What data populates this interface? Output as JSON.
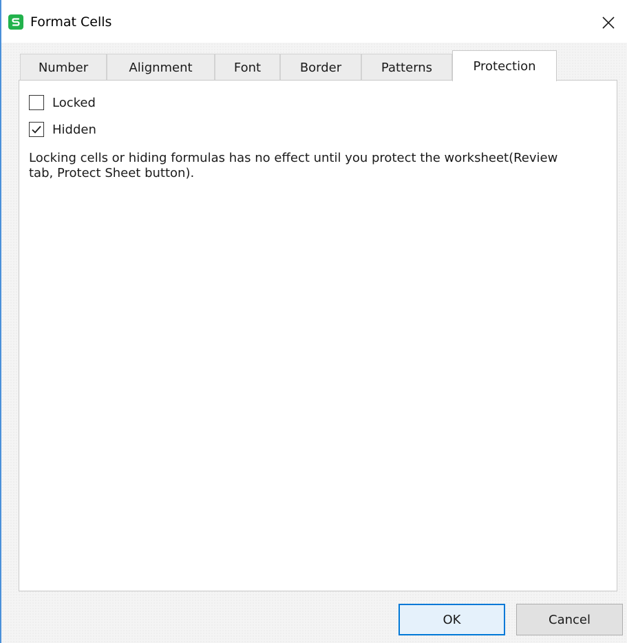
{
  "window": {
    "title": "Format Cells",
    "app_icon_letter": "S",
    "accent_color": "#0078d7",
    "icon_color": "#22b24c"
  },
  "tabs": [
    {
      "label": "Number",
      "active": false
    },
    {
      "label": "Alignment",
      "active": false
    },
    {
      "label": "Font",
      "active": false
    },
    {
      "label": "Border",
      "active": false
    },
    {
      "label": "Patterns",
      "active": false
    },
    {
      "label": "Protection",
      "active": true
    }
  ],
  "protection": {
    "locked": {
      "label": "Locked",
      "checked": false
    },
    "hidden": {
      "label": "Hidden",
      "checked": true
    },
    "note": "Locking cells or hiding formulas has no effect until you protect the worksheet(Review tab, Protect Sheet button)."
  },
  "buttons": {
    "ok": "OK",
    "cancel": "Cancel"
  },
  "icons": {
    "close": "close-icon",
    "check": "checkmark-icon",
    "app": "spreadsheet-app-icon"
  }
}
